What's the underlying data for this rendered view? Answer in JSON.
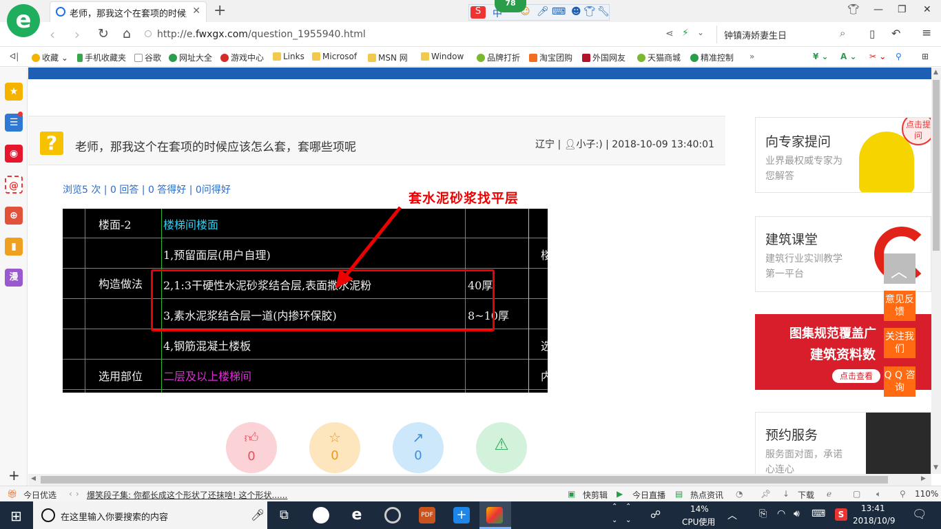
{
  "browser": {
    "tab_title": "老师，那我这个在套项的时候应该",
    "url_prefix": "http://e.",
    "url_domain": "fwxgx.com",
    "url_path": "/question_1955940.html",
    "search_text": "钟镇涛娇妻生日",
    "ime_badge": "78",
    "ime_label": "中"
  },
  "bookmarks": [
    "收藏",
    "手机收藏夹",
    "谷歌",
    "网址大全",
    "游戏中心",
    "Links",
    "Microsof",
    "MSN 网",
    "Window",
    "品牌打折",
    "淘宝团购",
    "外国网友",
    "天猫商城",
    "精准控制"
  ],
  "question": {
    "title": "老师，那我这个在套项的时候应该怎么套，套哪些项呢",
    "meta_region": "辽宁",
    "meta_user": "小子:)",
    "meta_time": "2018-10-09 13:40:01",
    "stats": "浏览5 次 | 0 回答 | 0 答得好 | 0问得好",
    "annotation": "套水泥砂浆找平层"
  },
  "cad": {
    "row1_label": "楼面-2",
    "row1_value": "楼梯间楼面",
    "line1": "1,预留面层(用户自理)",
    "section_label": "构造做法",
    "line2": "2,1:3干硬性水泥砂浆结合层,表面撒水泥粉",
    "line2_thick": "40厚",
    "line3": "3,素水泥浆结合层一道(内掺环保胶)",
    "line3_thick": "8~10厚",
    "line4": "4,钢筋混凝土楼板",
    "apply_label": "选用部位",
    "apply_value": "二层及以上楼梯间",
    "right_fragments": [
      "楼",
      "选",
      "内"
    ]
  },
  "actions": {
    "like": "0",
    "favorite": "0",
    "share": "0"
  },
  "right_column": {
    "card1_title": "向专家提问",
    "card1_desc": "业界最权威专家为您解答",
    "card1_bubble": "点击提问",
    "card2_title": "建筑课堂",
    "card2_desc": "建筑行业实训教学第一平台",
    "banner_line1": "图集规范覆盖广",
    "banner_line2": "建筑资料数",
    "banner_link": "点击查看",
    "card3_title": "预约服务",
    "card3_desc": "服务面对面，承诺心连心",
    "float_feedback": "意见反馈",
    "float_follow": "关注我们",
    "float_qq": "Q Q 咨询"
  },
  "statusbar": {
    "today": "今日优选",
    "news": "爆笑段子集: 你都长成这个形状了还抹啥! 这个形状......",
    "clip": "快剪辑",
    "live": "今日直播",
    "hot": "热点资讯",
    "download": "下载",
    "zoom": "110%"
  },
  "taskbar": {
    "search_placeholder": "在这里输入你要搜索的内容",
    "cpu_percent": "14%",
    "cpu_label": "CPU使用",
    "time": "13:41",
    "date": "2018/10/9"
  },
  "colors": {
    "brand_blue": "#1d5fb4",
    "accent_orange": "#ff6a13",
    "cad_green": "#2bb82b",
    "annotation_red": "#e00000"
  }
}
